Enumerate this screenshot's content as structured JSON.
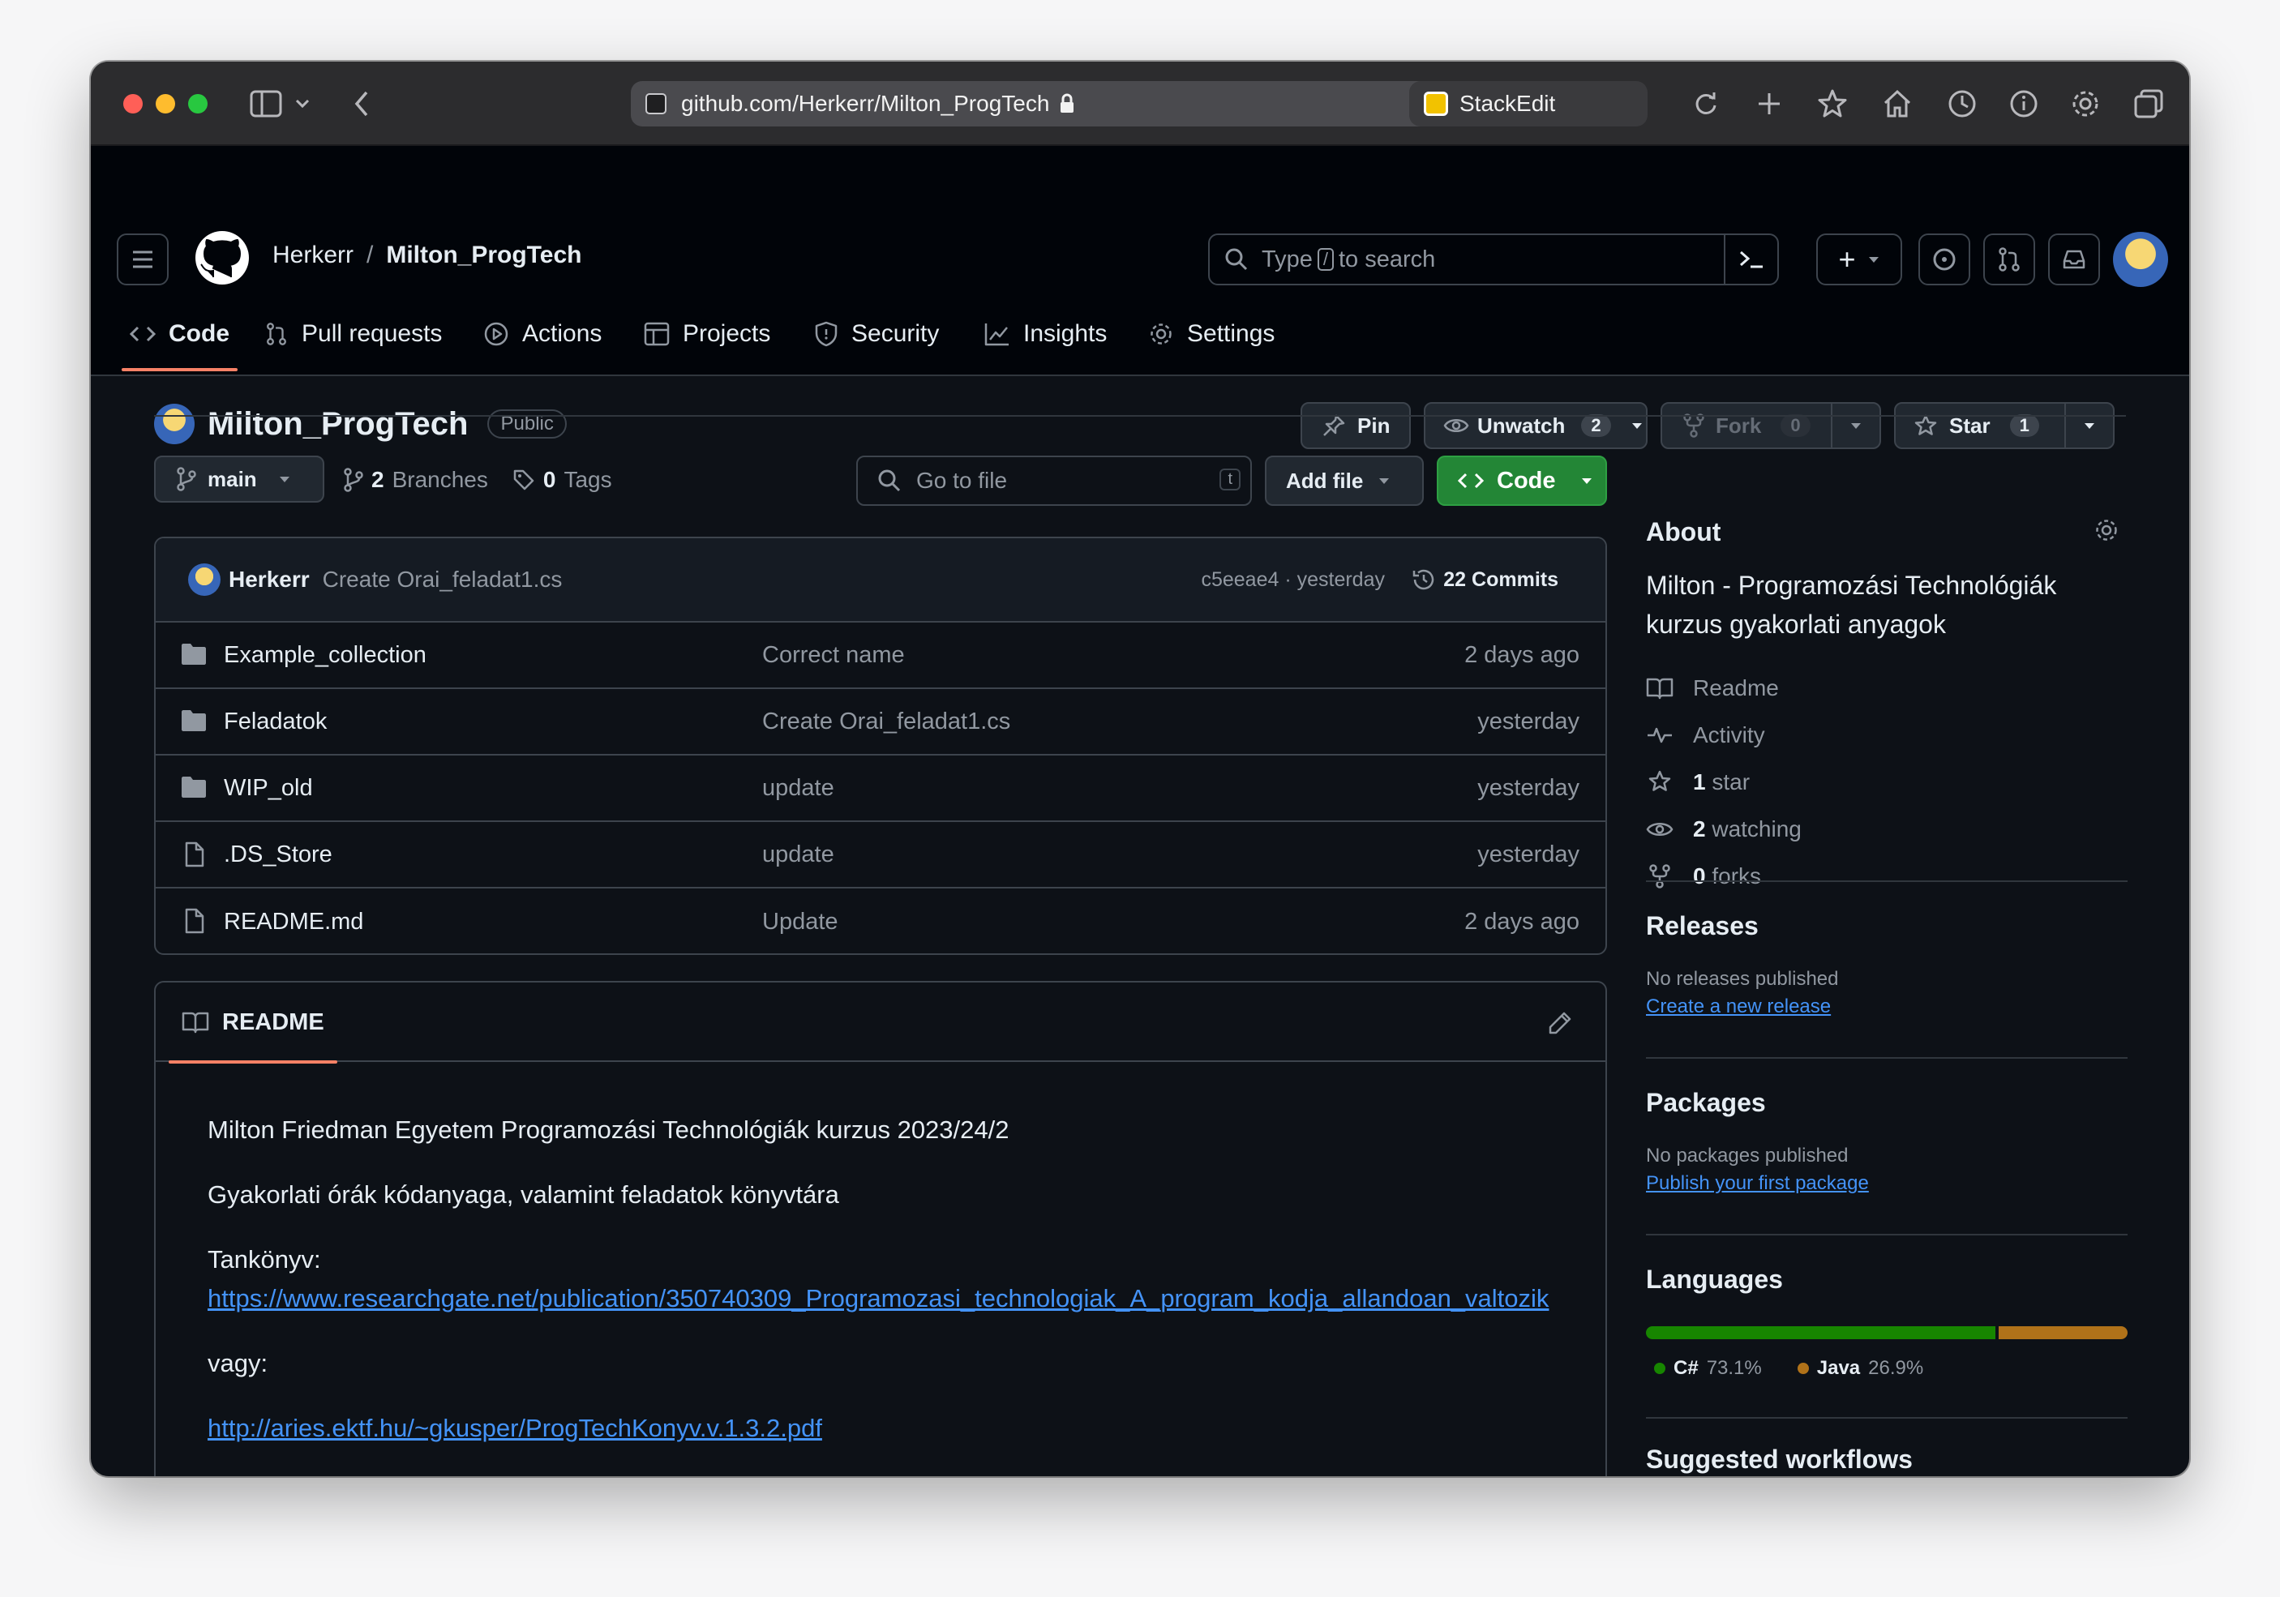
{
  "browser": {
    "url": "github.com/Herkerr/Milton_ProgTech",
    "second_tab": "StackEdit"
  },
  "header": {
    "owner": "Herkerr",
    "separator": "/",
    "repo": "Milton_ProgTech",
    "search_prefix": "Type",
    "search_key": "/",
    "search_suffix": "to search",
    "plus_label": "+"
  },
  "nav": {
    "tabs": [
      {
        "label": "Code",
        "icon": "code-icon"
      },
      {
        "label": "Pull requests",
        "icon": "git-pull-request-icon"
      },
      {
        "label": "Actions",
        "icon": "play-icon"
      },
      {
        "label": "Projects",
        "icon": "table-icon"
      },
      {
        "label": "Security",
        "icon": "shield-icon"
      },
      {
        "label": "Insights",
        "icon": "graph-icon"
      },
      {
        "label": "Settings",
        "icon": "gear-icon"
      }
    ]
  },
  "repo": {
    "name": "Milton_ProgTech",
    "visibility": "Public",
    "pin_label": "Pin",
    "watch_label": "Unwatch",
    "watch_count": "2",
    "fork_label": "Fork",
    "fork_count": "0",
    "star_label": "Star",
    "star_count": "1"
  },
  "toolbar": {
    "branch": "main",
    "branches_count": "2",
    "branches_label": "Branches",
    "tags_count": "0",
    "tags_label": "Tags",
    "goto_placeholder": "Go to file",
    "goto_key": "t",
    "add_file": "Add file",
    "code_button": "Code"
  },
  "latest_commit": {
    "author": "Herkerr",
    "message": "Create Orai_feladat1.cs",
    "sha_time": "c5eeae4 · yesterday",
    "commits_label": "22 Commits"
  },
  "files": [
    {
      "type": "folder",
      "name": "Example_collection",
      "message": "Correct name",
      "date": "2 days ago"
    },
    {
      "type": "folder",
      "name": "Feladatok",
      "message": "Create Orai_feladat1.cs",
      "date": "yesterday"
    },
    {
      "type": "folder",
      "name": "WIP_old",
      "message": "update",
      "date": "yesterday"
    },
    {
      "type": "file",
      "name": ".DS_Store",
      "message": "update",
      "date": "yesterday"
    },
    {
      "type": "file",
      "name": "README.md",
      "message": "Update",
      "date": "2 days ago"
    }
  ],
  "readme": {
    "tab": "README",
    "line1": "Milton Friedman Egyetem Programozási Technológiák kurzus 2023/24/2",
    "line2": "Gyakorlati órák kódanyaga, valamint feladatok könyvtára",
    "line3": "Tankönyv:",
    "link1": "https://www.researchgate.net/publication/350740309_Programozasi_technologiak_A_program_kodja_allandoan_valtozik",
    "line4": "vagy:",
    "link2": "http://aries.ektf.hu/~gkusper/ProgTechKonyv.v.1.3.2.pdf"
  },
  "sidebar": {
    "about_title": "About",
    "description": "Milton - Programozási Technológiák kurzus gyakorlati anyagok",
    "items": [
      {
        "icon": "book-icon",
        "bold": "",
        "label": "Readme"
      },
      {
        "icon": "pulse-icon",
        "bold": "",
        "label": "Activity"
      },
      {
        "icon": "star-icon",
        "bold": "1",
        "label": "star"
      },
      {
        "icon": "eye-icon",
        "bold": "2",
        "label": "watching"
      },
      {
        "icon": "fork-icon",
        "bold": "0",
        "label": "forks"
      }
    ],
    "releases_title": "Releases",
    "releases_note": "No releases published",
    "releases_link": "Create a new release",
    "packages_title": "Packages",
    "packages_note": "No packages published",
    "packages_link": "Publish your first package",
    "languages_title": "Languages",
    "languages": [
      {
        "name": "C#",
        "percent": "73.1%",
        "share": 73.1,
        "color": "#178600"
      },
      {
        "name": "Java",
        "percent": "26.9%",
        "share": 26.9,
        "color": "#b07219"
      }
    ],
    "workflows_title": "Suggested workflows"
  },
  "colors": {
    "accent_underline": "#f78166",
    "link": "#4493f8",
    "primary_button": "#238636"
  }
}
